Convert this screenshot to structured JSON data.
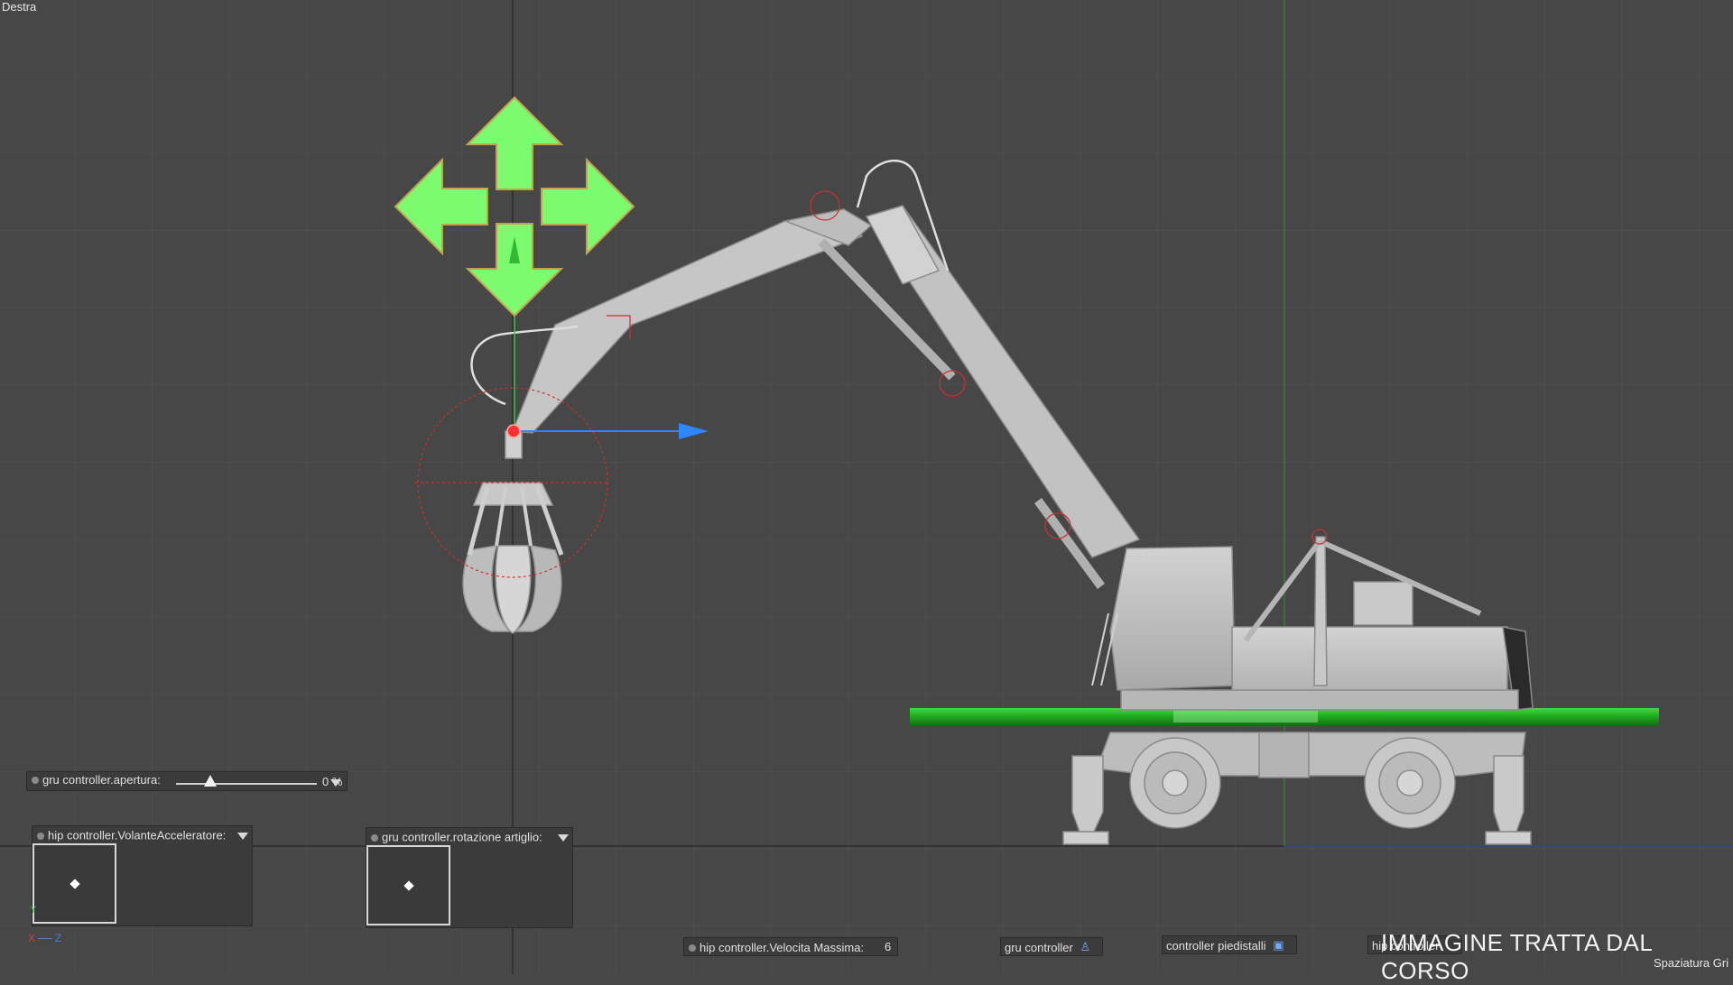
{
  "viewport": {
    "title": "Destra",
    "grid_label": "Spaziatura Gri",
    "watermark": "IMMAGINE TRATTA DAL CORSO",
    "axes": {
      "x": "X",
      "z": "Z"
    }
  },
  "hud": {
    "apertura": {
      "label": "gru controller.apertura:",
      "value": "0 %"
    },
    "volante": {
      "label": "hip controller.VolanteAcceleratore:"
    },
    "rotazione": {
      "label": "gru controller.rotazione artiglio:"
    },
    "velocita": {
      "label": "hip controller.Velocita Massima:",
      "value": "6"
    },
    "gru_controller": {
      "label": "gru controller"
    },
    "piedistalli": {
      "label": "controller piedistalli"
    },
    "hip_partial": {
      "label": "hip controller"
    }
  },
  "colors": {
    "background": "#474747",
    "grid": "#525252",
    "move_gizmo": "#7dfb6f",
    "selection_bar": "#1db21d",
    "axis_x": "#d04040",
    "axis_y": "#40b040",
    "axis_z": "#2f86ff",
    "model": "#c4c4c4"
  }
}
